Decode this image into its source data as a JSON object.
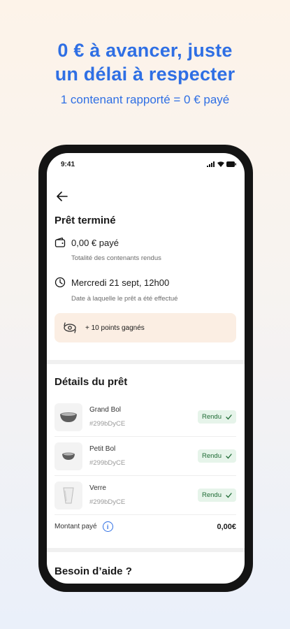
{
  "promo": {
    "title_line1": "0 € à avancer, juste",
    "title_line2": "un délai à respecter",
    "subtitle": "1 contenant rapporté = 0 € payé"
  },
  "status_bar": {
    "time": "9:41"
  },
  "loan": {
    "title": "Prêt terminé",
    "paid": "0,00 € payé",
    "paid_hint": "Totalité des contenants rendus",
    "date": "Mercredi 21 sept, 12h00",
    "date_hint": "Date à laquelle le prêt a été effectué",
    "points": "+ 10 points gagnés"
  },
  "details": {
    "title": "Détails du prêt",
    "items": [
      {
        "name": "Grand Bol",
        "code": "#299bDyCE",
        "status": "Rendu"
      },
      {
        "name": "Petit Bol",
        "code": "#299bDyCE",
        "status": "Rendu"
      },
      {
        "name": "Verre",
        "code": "#299bDyCE",
        "status": "Rendu"
      }
    ],
    "amount_label": "Montant payé",
    "amount_value": "0,00€"
  },
  "help": {
    "title": "Besoin d’aide ?"
  },
  "colors": {
    "accent": "#2f6fe4",
    "points_bg": "#fbeee3",
    "badge_bg": "#e6f4ea",
    "badge_text": "#1f6b35"
  }
}
